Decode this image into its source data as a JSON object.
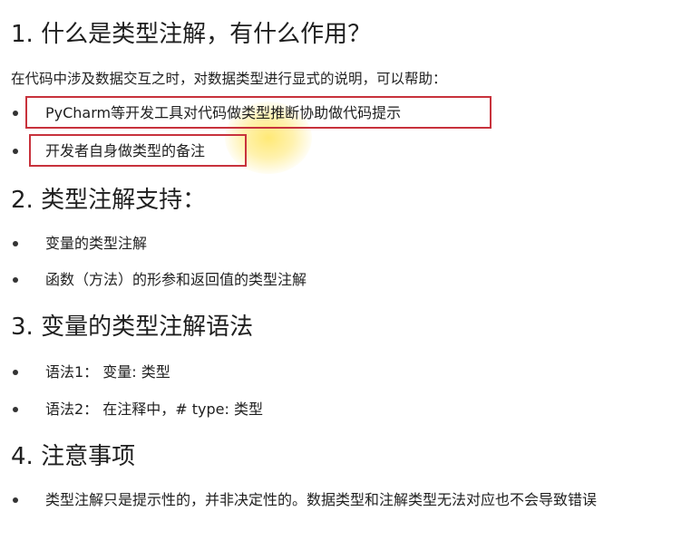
{
  "sections": [
    {
      "heading": "1. 什么是类型注解，有什么作用？",
      "paragraph": "在代码中涉及数据交互之时，对数据类型进行显式的说明，可以帮助：",
      "items": [
        "PyCharm等开发工具对代码做类型推断协助做代码提示",
        "开发者自身做类型的备注"
      ]
    },
    {
      "heading": "2. 类型注解支持：",
      "items": [
        "变量的类型注解",
        "函数（方法）的形参和返回值的类型注解"
      ]
    },
    {
      "heading": "3. 变量的类型注解语法",
      "items": [
        "语法1：  变量: 类型",
        "语法2：  在注释中，# type: 类型"
      ]
    },
    {
      "heading": "4. 注意事项",
      "items": [
        "类型注解只是提示性的，并非决定性的。数据类型和注解类型无法对应也不会导致错误"
      ]
    }
  ],
  "highlight_color": "#c8323c"
}
